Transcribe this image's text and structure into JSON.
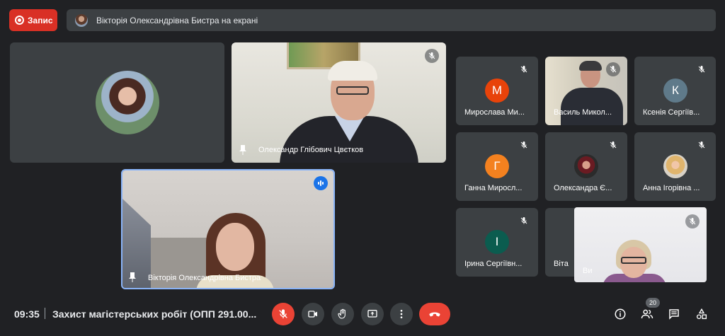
{
  "top_bar": {
    "record_label": "Запис",
    "presenting_text": "Вікторія Олександрівна Бистра на екрані"
  },
  "participants": {
    "vika_tile": {
      "avatar": "photo"
    },
    "speaker": {
      "name": "Олександр Глібович Цвєтков",
      "muted": true
    },
    "presenter": {
      "name": "Вікторія Олександрівна Бистра",
      "speaking": true
    },
    "grid": [
      {
        "name": "Мирослава Ми...",
        "initial": "М",
        "color": "#e8430a",
        "muted": true
      },
      {
        "name": "Василь Микол...",
        "video": true,
        "muted": true
      },
      {
        "name": "Ксенія Сергіїв...",
        "initial": "К",
        "color": "#5f7a8a",
        "muted": true
      },
      {
        "name": "Ганна Миросл...",
        "initial": "Г",
        "color": "#f4811f",
        "muted": true
      },
      {
        "name": "Олександра Є...",
        "avatar": "photo",
        "muted": true
      },
      {
        "name": "Анна Ігорівна ...",
        "avatar": "photo",
        "muted": true
      },
      {
        "name": "Ірина Сергіївн...",
        "initial": "І",
        "color": "#0b5c4f",
        "muted": true
      },
      {
        "name": "Віта"
      }
    ],
    "self": {
      "name": "Ви",
      "muted": true
    }
  },
  "bottom_bar": {
    "time": "09:35",
    "meeting_title": "Захист магістерських робіт (ОПП 291.00...",
    "participant_count": "20"
  },
  "colors": {
    "background": "#202124",
    "tile": "#3c4043",
    "accent_red": "#ea4335",
    "speaking_border": "#8ab4f8"
  }
}
